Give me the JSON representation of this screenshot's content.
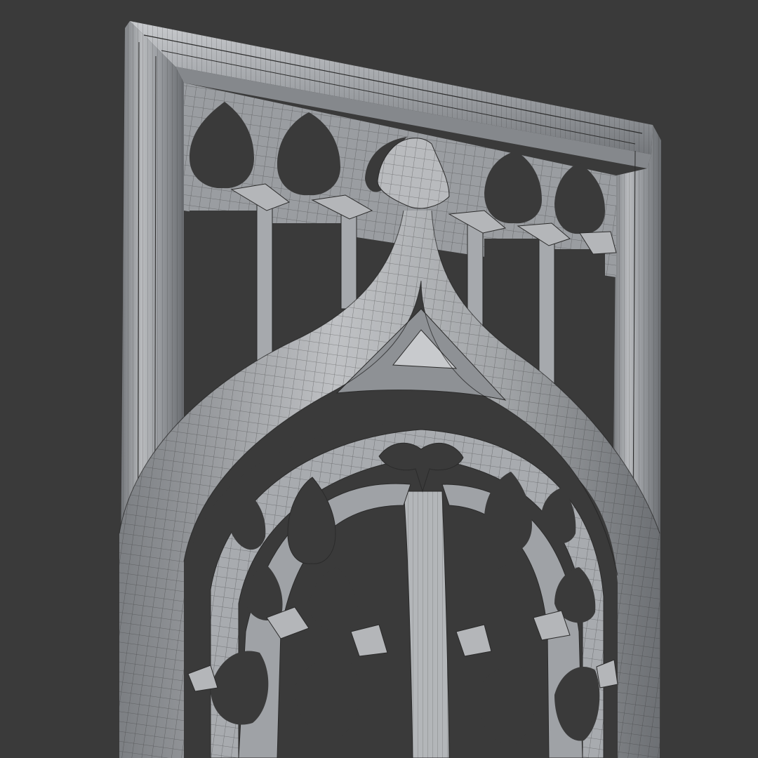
{
  "scene": {
    "subject": "gothic-tracery-window-panel",
    "render_style": "clay-wireframe",
    "colors": {
      "background": "#3a3a3a",
      "surface": "#9c9fa3",
      "surface_light": "#c4c6c9",
      "surface_shadow": "#5f6266",
      "wire": "#1c1c1c"
    }
  }
}
